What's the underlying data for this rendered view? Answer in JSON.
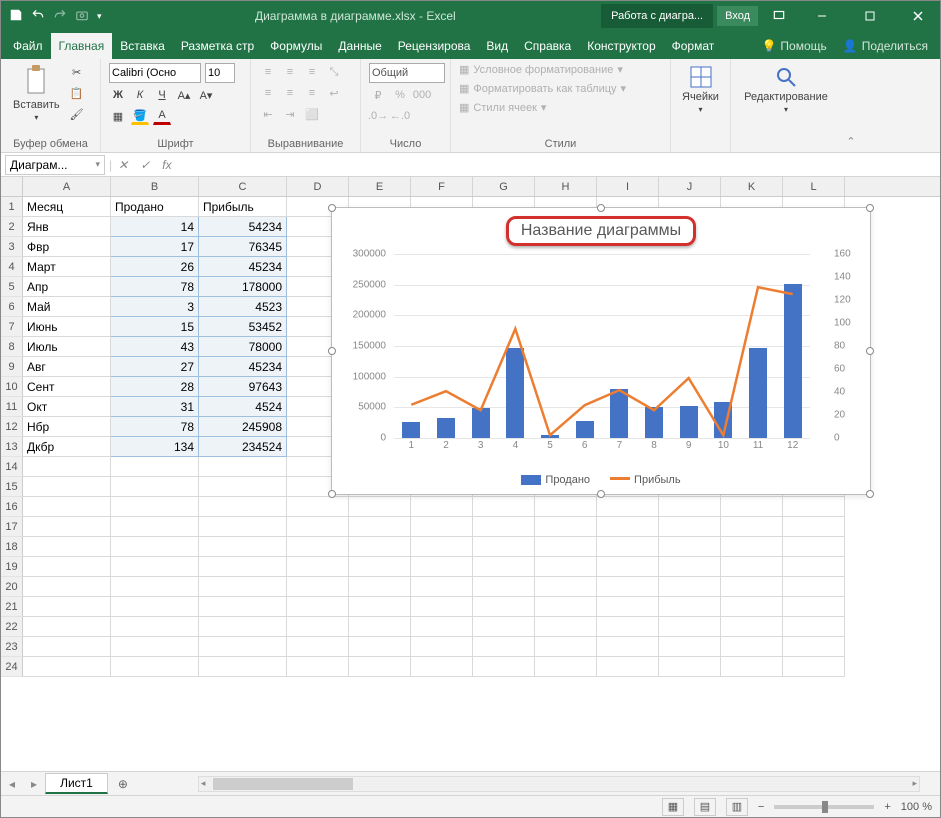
{
  "titlebar": {
    "doc_title": "Диаграмма в диаграмме.xlsx - Excel",
    "tools_tab": "Работа с диагра...",
    "login": "Вход"
  },
  "tabs": {
    "file": "Файл",
    "home": "Главная",
    "insert": "Вставка",
    "layout": "Разметка стр",
    "formulas": "Формулы",
    "data": "Данные",
    "review": "Рецензирова",
    "view": "Вид",
    "help": "Справка",
    "design": "Конструктор",
    "format": "Формат",
    "tell_me": "Помощь",
    "share": "Поделиться"
  },
  "ribbon": {
    "paste": "Вставить",
    "clipboard": "Буфер обмена",
    "font_name": "Calibri (Осно",
    "font_size": "10",
    "font_group": "Шрифт",
    "align_group": "Выравнивание",
    "number_format": "Общий",
    "number_group": "Число",
    "cond_fmt": "Условное форматирование",
    "as_table": "Форматировать как таблицу",
    "cell_styles": "Стили ячеек",
    "styles_group": "Стили",
    "cells": "Ячейки",
    "editing": "Редактирование",
    "bold": "Ж",
    "italic": "К",
    "underline": "Ч"
  },
  "formula_bar": {
    "name_box": "Диаграм...",
    "fx": "fx",
    "formula": ""
  },
  "columns": [
    "A",
    "B",
    "C",
    "D",
    "E",
    "F",
    "G",
    "H",
    "I",
    "J",
    "K",
    "L"
  ],
  "table": {
    "headers": {
      "month": "Месяц",
      "sold": "Продано",
      "profit": "Прибыль"
    },
    "rows": [
      {
        "m": "Янв",
        "s": 14,
        "p": 54234
      },
      {
        "m": "Фвр",
        "s": 17,
        "p": 76345
      },
      {
        "m": "Март",
        "s": 26,
        "p": 45234
      },
      {
        "m": "Апр",
        "s": 78,
        "p": 178000
      },
      {
        "m": "Май",
        "s": 3,
        "p": 4523
      },
      {
        "m": "Июнь",
        "s": 15,
        "p": 53452
      },
      {
        "m": "Июль",
        "s": 43,
        "p": 78000
      },
      {
        "m": "Авг",
        "s": 27,
        "p": 45234
      },
      {
        "m": "Сент",
        "s": 28,
        "p": 97643
      },
      {
        "m": "Окт",
        "s": 31,
        "p": 4524
      },
      {
        "m": "Нбр",
        "s": 78,
        "p": 245908
      },
      {
        "m": "Дкбр",
        "s": 134,
        "p": 234524
      }
    ]
  },
  "chart_data": {
    "type": "bar",
    "title": "Название диаграммы",
    "categories": [
      1,
      2,
      3,
      4,
      5,
      6,
      7,
      8,
      9,
      10,
      11,
      12
    ],
    "series": [
      {
        "name": "Продано",
        "type": "bar",
        "axis": "right",
        "values": [
          14,
          17,
          26,
          78,
          3,
          15,
          43,
          27,
          28,
          31,
          78,
          134
        ]
      },
      {
        "name": "Прибыль",
        "type": "line",
        "axis": "left",
        "values": [
          54234,
          76345,
          45234,
          178000,
          4523,
          53452,
          78000,
          45234,
          97643,
          4524,
          245908,
          234524
        ]
      }
    ],
    "y_left": {
      "min": 0,
      "max": 300000,
      "ticks": [
        0,
        50000,
        100000,
        150000,
        200000,
        250000,
        300000
      ]
    },
    "y_right": {
      "min": 0,
      "max": 160,
      "ticks": [
        0,
        20,
        40,
        60,
        80,
        100,
        120,
        140,
        160
      ]
    },
    "legend": [
      "Продано",
      "Прибыль"
    ],
    "colors": {
      "bar": "#4472c4",
      "line": "#ed7d31"
    }
  },
  "sheet": {
    "tab1": "Лист1"
  },
  "status": {
    "zoom": "100 %"
  }
}
